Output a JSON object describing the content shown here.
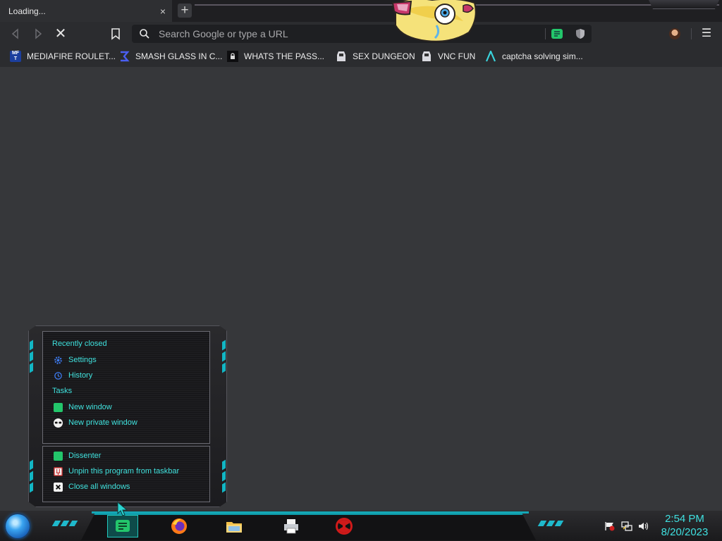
{
  "tab": {
    "title": "Loading...",
    "close_glyph": "×",
    "new_tab_glyph": "+"
  },
  "toolbar": {
    "back_icon": "back-arrow-icon",
    "forward_icon": "forward-arrow-icon",
    "stop_icon": "stop-loading-icon",
    "stop_glyph": "✕",
    "bookmark_icon": "bookmark-icon",
    "search_placeholder": "Search Google or type a URL",
    "menu_glyph": "☰"
  },
  "bookmarks": [
    {
      "label": "MEDIAFIRE ROULET...",
      "icon": "mediafire-icon"
    },
    {
      "label": "SMASH GLASS IN C...",
      "icon": "blue-sigma-icon"
    },
    {
      "label": "WHATS THE PASS...",
      "icon": "lock-icon"
    },
    {
      "label": "SEX DUNGEON",
      "icon": "arcade-machine-icon"
    },
    {
      "label": "VNC FUN",
      "icon": "arcade-machine-icon"
    },
    {
      "label": "captcha solving sim...",
      "icon": "teal-chevron-icon"
    }
  ],
  "jumplist": {
    "recent_heading": "Recently closed",
    "recent_items": [
      {
        "label": "Settings",
        "icon": "gear-icon"
      },
      {
        "label": "History",
        "icon": "history-clock-icon"
      }
    ],
    "tasks_heading": "Tasks",
    "task_items": [
      {
        "label": "New window",
        "icon": "dissenter-icon"
      },
      {
        "label": "New private window",
        "icon": "private-mask-icon"
      }
    ],
    "pinned_items": [
      {
        "label": "Dissenter",
        "icon": "dissenter-icon"
      },
      {
        "label": "Unpin this program from taskbar",
        "icon": "unpin-icon"
      },
      {
        "label": "Close all windows",
        "icon": "close-x-icon"
      }
    ]
  },
  "taskbar": {
    "apps": [
      {
        "name": "Dissenter",
        "icon": "dissenter-icon",
        "active": true
      },
      {
        "name": "Firefox",
        "icon": "firefox-icon",
        "active": false
      },
      {
        "name": "File Explorer",
        "icon": "folder-icon",
        "active": false
      },
      {
        "name": "Printer",
        "icon": "printer-icon",
        "active": false
      },
      {
        "name": "Radiation",
        "icon": "radiation-icon",
        "active": false
      }
    ],
    "tray": [
      "flag-icon",
      "network-icon",
      "volume-icon"
    ],
    "time": "2:54 PM",
    "date": "8/20/2023"
  },
  "colors": {
    "accent_cyan": "#3fe0e0",
    "dissenter_green": "#23c66b",
    "content_bg": "#36373a"
  }
}
